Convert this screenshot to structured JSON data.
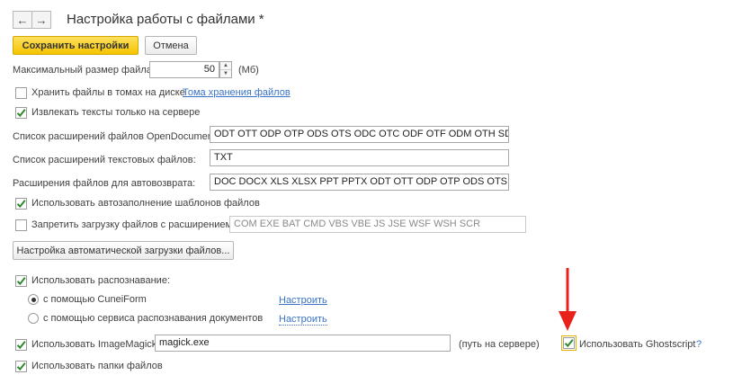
{
  "header": {
    "back_icon": "arrow-left-icon",
    "forward_icon": "arrow-right-icon",
    "back_glyph": "←",
    "forward_glyph": "→",
    "title": "Настройка работы с файлами *"
  },
  "toolbar": {
    "save_label": "Сохранить настройки",
    "cancel_label": "Отмена"
  },
  "max_size": {
    "label": "Максимальный размер файла:",
    "value": "50",
    "unit": "(Мб)"
  },
  "store_volumes": {
    "label": "Хранить файлы в томах на диске",
    "checked": false,
    "link": "Тома хранения файлов"
  },
  "extract_texts": {
    "label": "Извлекать тексты только на сервере",
    "checked": true
  },
  "opendoc": {
    "label": "Список расширений файлов OpenDocument:",
    "value": "ODT OTT ODP OTP ODS OTS ODC OTC ODF OTF ODM OTH SDW"
  },
  "text_ext": {
    "label": "Список расширений текстовых файлов:",
    "value": "TXT"
  },
  "autoreturn": {
    "label": "Расширения файлов для автовозврата:",
    "value": "DOC DOCX XLS XLSX PPT PPTX ODT OTT ODP OTP ODS OTS ODC"
  },
  "autofill": {
    "label": "Использовать автозаполнение шаблонов файлов",
    "checked": true
  },
  "forbid": {
    "label": "Запретить загрузку файлов с расширением:",
    "checked": false,
    "value": "COM EXE BAT CMD VBS VBE JS JSE WSF WSH SCR"
  },
  "autoload_button": "Настройка автоматической загрузки файлов...",
  "recognition": {
    "label": "Использовать распознавание:",
    "checked": true,
    "options": [
      {
        "label": "с помощью CuneiForm",
        "selected": true,
        "link": "Настроить"
      },
      {
        "label": "с помощью сервиса распознавания документов",
        "selected": false,
        "link": "Настроить"
      }
    ]
  },
  "imagemagick": {
    "label": "Использовать ImageMagick",
    "checked": true,
    "value": "magick.exe",
    "hint": "(путь на сервере)"
  },
  "ghostscript": {
    "label": "Использовать Ghostscript",
    "checked": true,
    "help": "?"
  },
  "file_folders": {
    "label": "Использовать папки файлов",
    "checked": true
  },
  "colors": {
    "accent_yellow": "#f5c400",
    "link_blue": "#3a73c6",
    "check_green": "#2f8a2f",
    "annotation_red": "#e8211b"
  }
}
